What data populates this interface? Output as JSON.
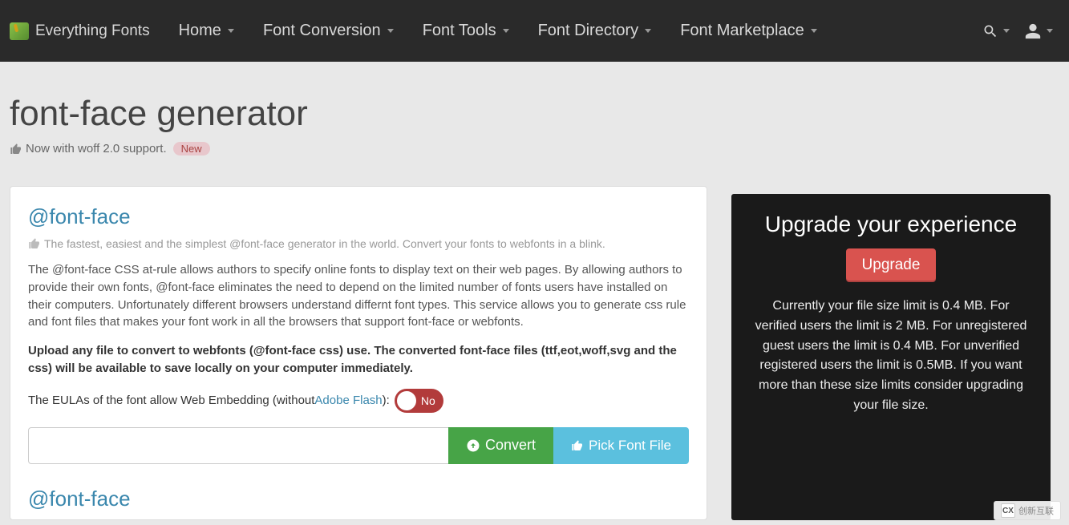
{
  "nav": {
    "brand": "Everything Fonts",
    "items": [
      "Home",
      "Font Conversion",
      "Font Tools",
      "Font Directory",
      "Font Marketplace"
    ]
  },
  "hero": {
    "title": "font-face generator",
    "subtitle": "Now with woff 2.0 support.",
    "badge": "New"
  },
  "main": {
    "heading": "@font-face",
    "tagline": "The fastest, easiest and the simplest @font-face generator in the world. Convert your fonts to webfonts in a blink.",
    "para1": "The @font-face CSS at-rule allows authors to specify online fonts to display text on their web pages. By allowing authors to provide their own fonts, @font-face eliminates the need to depend on the limited number of fonts users have installed on their computers. Unfortunately different browsers understand differnt font types. This service allows you to generate css rule and font files that makes your font work in all the browsers that support font-face or webfonts.",
    "para2": "Upload any file to convert to webfonts (@font-face css) use. The converted font-face files (ttf,eot,woff,svg and the css) will be available to save locally on your computer immediately.",
    "eula_prefix": "The EULAs of the font allow Web Embedding (without ",
    "eula_link": "Adobe Flash",
    "eula_suffix": "):",
    "toggle_label": "No",
    "convert_label": "Convert",
    "pick_label": "Pick Font File",
    "section2_heading": "@font-face"
  },
  "sidebar": {
    "title": "Upgrade your experience",
    "button": "Upgrade",
    "text": "Currently your file size limit is 0.4 MB. For verified users the limit is 2 MB. For unregistered guest users the limit is 0.4 MB. For unverified registered users the limit is 0.5MB. If you want more than these size limits consider upgrading your file size."
  },
  "watermark": "创新互联"
}
